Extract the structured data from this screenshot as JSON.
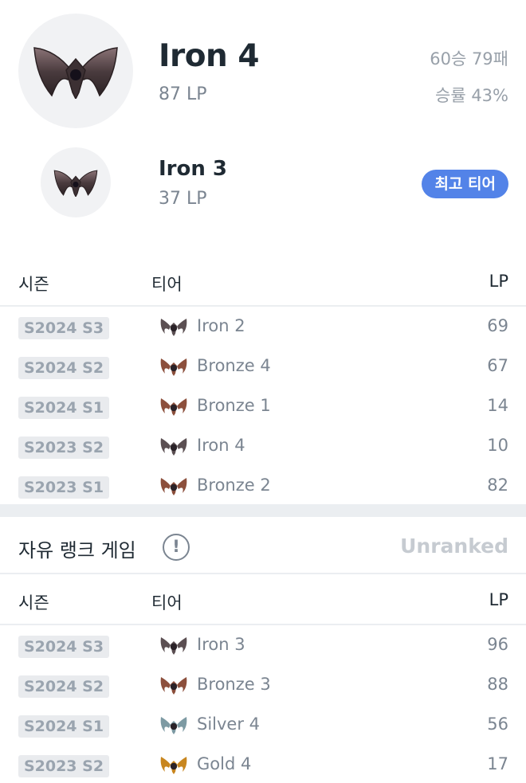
{
  "current": {
    "tier": "Iron 4",
    "lp": "87 LP",
    "win_loss": "60승 79패",
    "win_rate": "승률 43%",
    "emblem": "iron-emblem"
  },
  "peak": {
    "tier": "Iron 3",
    "lp": "37 LP",
    "badge": "최고 티어",
    "emblem": "iron-emblem"
  },
  "solo_history": {
    "headers": {
      "season": "시즌",
      "tier": "티어",
      "lp": "LP"
    },
    "rows": [
      {
        "season": "S2024 S3",
        "tier": "Iron 2",
        "lp": "69",
        "icon": "iron-icon",
        "color": "#5b4f52"
      },
      {
        "season": "S2024 S2",
        "tier": "Bronze 4",
        "lp": "67",
        "icon": "bronze-icon",
        "color": "#8c4f3c"
      },
      {
        "season": "S2024 S1",
        "tier": "Bronze 1",
        "lp": "14",
        "icon": "bronze-icon",
        "color": "#8c4f3c"
      },
      {
        "season": "S2023 S2",
        "tier": "Iron 4",
        "lp": "10",
        "icon": "iron-icon",
        "color": "#5b4f52"
      },
      {
        "season": "S2023 S1",
        "tier": "Bronze 2",
        "lp": "82",
        "icon": "bronze-icon",
        "color": "#8c4f3c"
      }
    ]
  },
  "flex": {
    "title": "자유 랭크 게임",
    "info_icon": "!",
    "status": "Unranked"
  },
  "flex_history": {
    "headers": {
      "season": "시즌",
      "tier": "티어",
      "lp": "LP"
    },
    "rows": [
      {
        "season": "S2024 S3",
        "tier": "Iron 3",
        "lp": "96",
        "icon": "iron-icon",
        "color": "#5b4f52"
      },
      {
        "season": "S2024 S2",
        "tier": "Bronze 3",
        "lp": "88",
        "icon": "bronze-icon",
        "color": "#8c4f3c"
      },
      {
        "season": "S2024 S1",
        "tier": "Silver 4",
        "lp": "56",
        "icon": "silver-icon",
        "color": "#7d9aa3"
      },
      {
        "season": "S2023 S2",
        "tier": "Gold 4",
        "lp": "17",
        "icon": "gold-icon",
        "color": "#c8861f"
      }
    ]
  },
  "colors": {
    "accent": "#5383e8",
    "iron": "#5b4f52",
    "bronze": "#8c4f3c",
    "silver": "#7d9aa3",
    "gold": "#c8861f"
  }
}
